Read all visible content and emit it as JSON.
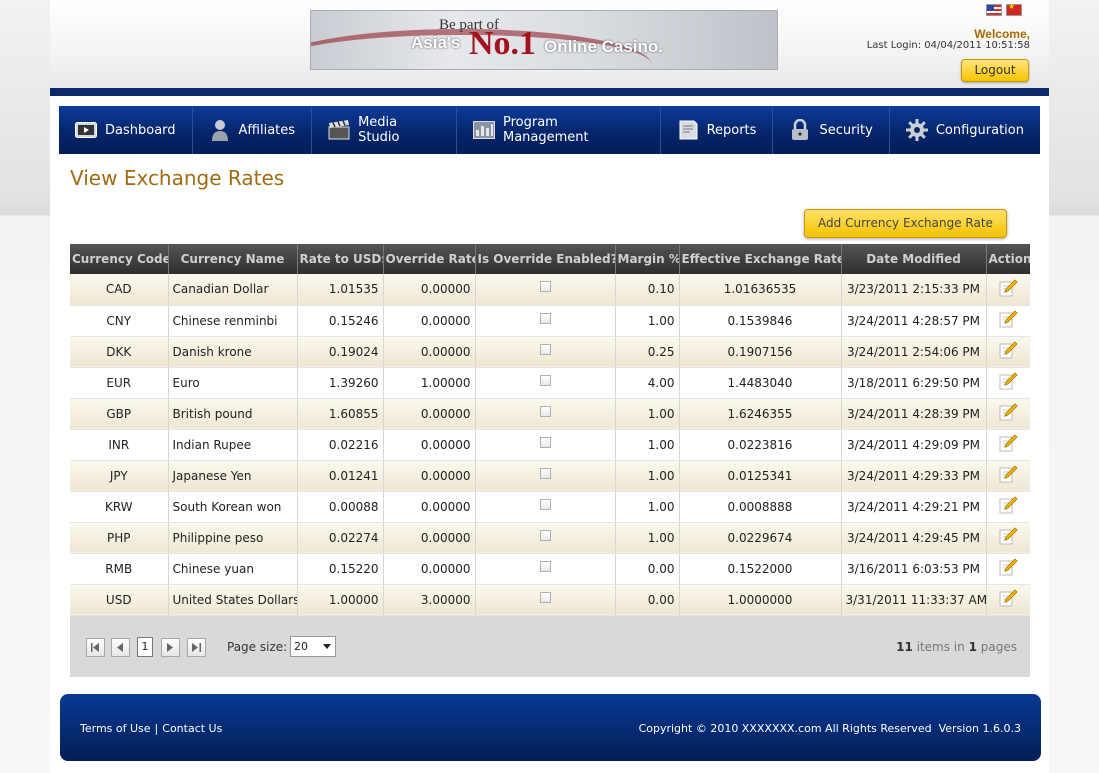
{
  "header": {
    "banner": {
      "line1": "Be part of",
      "line2": "Asia's",
      "line_no1": "No.1",
      "line3": "Online Casino."
    },
    "welcome": "Welcome,",
    "last_login": "Last Login: 04/04/2011 10:51:58",
    "logout_label": "Logout"
  },
  "nav": {
    "items": [
      {
        "label": "Dashboard",
        "icon": "dashboard-icon"
      },
      {
        "label": "Affiliates",
        "icon": "user-icon"
      },
      {
        "label": "Media Studio",
        "icon": "clapperboard-icon"
      },
      {
        "label": "Program Management",
        "icon": "program-icon"
      },
      {
        "label": "Reports",
        "icon": "report-icon"
      },
      {
        "label": "Security",
        "icon": "lock-icon"
      },
      {
        "label": "Configuration",
        "icon": "gear-icon"
      }
    ]
  },
  "main": {
    "title": "View Exchange Rates",
    "add_button": "Add Currency Exchange Rate",
    "table": {
      "columns": [
        "Currency Code",
        "Currency Name",
        "Rate to USD$",
        "Override Rate",
        "Is Override Enabled?",
        "Margin %",
        "Effective Exchange Rate",
        "Date Modified",
        "Action"
      ],
      "rows": [
        {
          "code": "CAD",
          "name": "Canadian Dollar",
          "rate": "1.01535",
          "override": "0.00000",
          "enabled": false,
          "margin": "0.10",
          "effective": "1.01636535",
          "modified": "3/23/2011 2:15:33 PM"
        },
        {
          "code": "CNY",
          "name": "Chinese renminbi",
          "rate": "0.15246",
          "override": "0.00000",
          "enabled": false,
          "margin": "1.00",
          "effective": "0.1539846",
          "modified": "3/24/2011 4:28:57 PM"
        },
        {
          "code": "DKK",
          "name": "Danish krone",
          "rate": "0.19024",
          "override": "0.00000",
          "enabled": false,
          "margin": "0.25",
          "effective": "0.1907156",
          "modified": "3/24/2011 2:54:06 PM"
        },
        {
          "code": "EUR",
          "name": "Euro",
          "rate": "1.39260",
          "override": "1.00000",
          "enabled": false,
          "margin": "4.00",
          "effective": "1.4483040",
          "modified": "3/18/2011 6:29:50 PM"
        },
        {
          "code": "GBP",
          "name": "British pound",
          "rate": "1.60855",
          "override": "0.00000",
          "enabled": false,
          "margin": "1.00",
          "effective": "1.6246355",
          "modified": "3/24/2011 4:28:39 PM"
        },
        {
          "code": "INR",
          "name": "Indian Rupee",
          "rate": "0.02216",
          "override": "0.00000",
          "enabled": false,
          "margin": "1.00",
          "effective": "0.0223816",
          "modified": "3/24/2011 4:29:09 PM"
        },
        {
          "code": "JPY",
          "name": "Japanese Yen",
          "rate": "0.01241",
          "override": "0.00000",
          "enabled": false,
          "margin": "1.00",
          "effective": "0.0125341",
          "modified": "3/24/2011 4:29:33 PM"
        },
        {
          "code": "KRW",
          "name": "South Korean won",
          "rate": "0.00088",
          "override": "0.00000",
          "enabled": false,
          "margin": "1.00",
          "effective": "0.0008888",
          "modified": "3/24/2011 4:29:21 PM"
        },
        {
          "code": "PHP",
          "name": "Philippine peso",
          "rate": "0.02274",
          "override": "0.00000",
          "enabled": false,
          "margin": "1.00",
          "effective": "0.0229674",
          "modified": "3/24/2011 4:29:45 PM"
        },
        {
          "code": "RMB",
          "name": "Chinese yuan",
          "rate": "0.15220",
          "override": "0.00000",
          "enabled": false,
          "margin": "0.00",
          "effective": "0.1522000",
          "modified": "3/16/2011 6:03:53 PM"
        },
        {
          "code": "USD",
          "name": "United States Dollars",
          "rate": "1.00000",
          "override": "3.00000",
          "enabled": false,
          "margin": "0.00",
          "effective": "1.0000000",
          "modified": "3/31/2011 11:33:37 AM"
        }
      ]
    },
    "pager": {
      "current_page": "1",
      "page_size_label": "Page size:",
      "page_size": "20",
      "items": "11",
      "items_in": "items in",
      "pages": "1",
      "pages_label": "pages"
    }
  },
  "footer": {
    "terms": "Terms of Use",
    "separator": "|",
    "contact": "Contact Us",
    "copyright": "Copyright © 2010 XXXXXXX.com All Rights Reserved  Version 1.6.0.3"
  },
  "colors": {
    "nav_bg": "#06256b",
    "title": "#a06c13",
    "button": "#f3c200",
    "footer_bg": "#041e57"
  }
}
